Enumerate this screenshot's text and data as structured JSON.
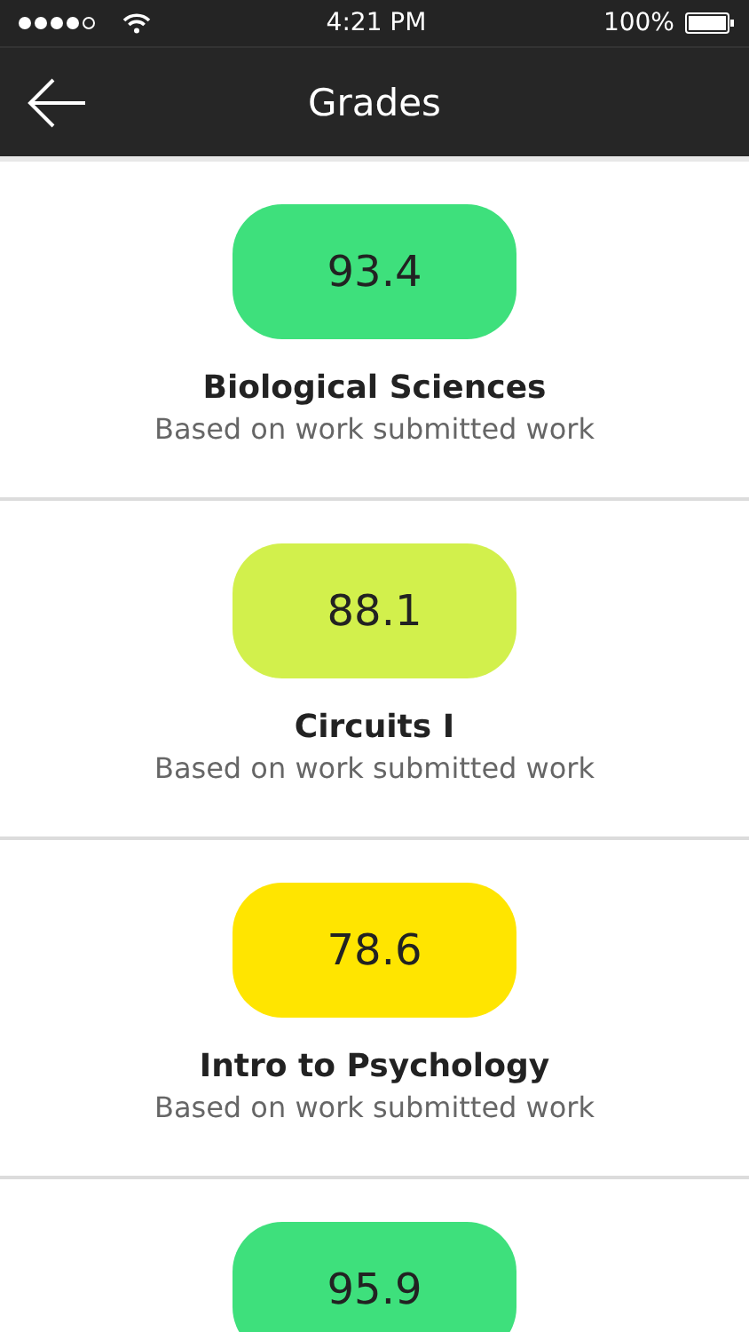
{
  "status_bar": {
    "time": "4:21 PM",
    "battery": "100%"
  },
  "nav": {
    "title": "Grades"
  },
  "courses": [
    {
      "grade": "93.4",
      "color": "#3ee07c",
      "name": "Biological Sciences",
      "note": "Based on work submitted work"
    },
    {
      "grade": "88.1",
      "color": "#d2f04c",
      "name": "Circuits I",
      "note": "Based on work submitted work"
    },
    {
      "grade": "78.6",
      "color": "#ffe500",
      "name": "Intro to Psychology",
      "note": "Based on work submitted work"
    },
    {
      "grade": "95.9",
      "color": "#3ee07c"
    }
  ]
}
